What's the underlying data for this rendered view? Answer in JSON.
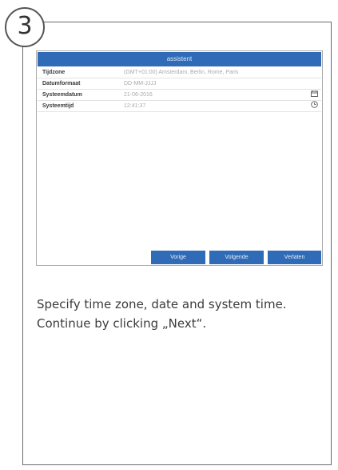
{
  "step": {
    "number": "3"
  },
  "dialog": {
    "title": "assistent",
    "rows": [
      {
        "label": "Tijdzone",
        "value": "(GMT+01:00) Amsterdam, Berlin, Rome, Paris",
        "icon": ""
      },
      {
        "label": "Datumformaat",
        "value": "DD-MM-JJJJ",
        "icon": ""
      },
      {
        "label": "Systeemdatum",
        "value": "21-06-2016",
        "icon": "calendar-icon"
      },
      {
        "label": "Systeemtijd",
        "value": "12:41:37",
        "icon": "clock-icon"
      }
    ],
    "buttons": {
      "prev": "Vorige",
      "next": "Volgende",
      "exit": "Verlaten"
    }
  },
  "description": "Specify time zone, date and system time. Continue by clicking „Next“.",
  "colors": {
    "accent": "#2f6bb6"
  }
}
